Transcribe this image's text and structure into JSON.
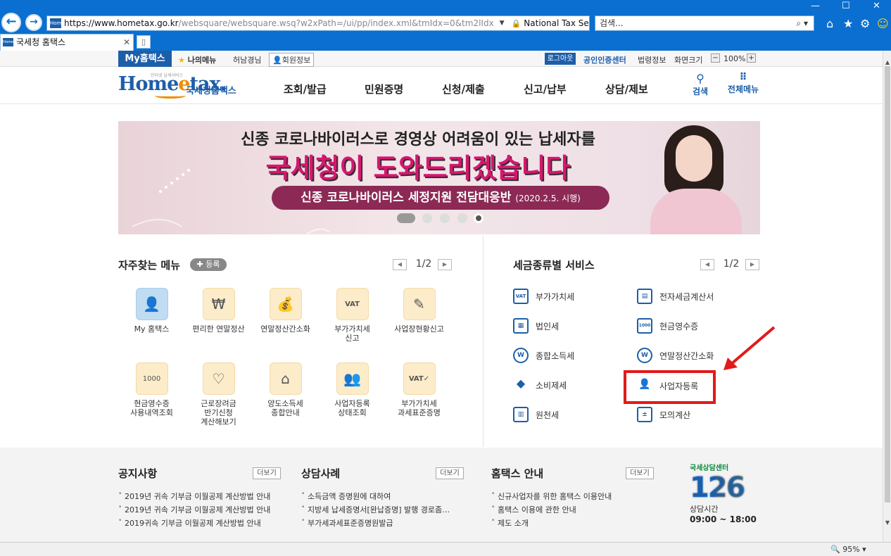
{
  "browser": {
    "url_main": "https://www.hometax.go.kr",
    "url_rest": "/websquare/websquare.wsq?w2xPath=/ui/pp/index.xml&tmIdx=0&tm2lIdx",
    "site_identity": "National Tax Service [KR]",
    "search_placeholder": "검색...",
    "tab_title": "국세청 홈택스",
    "favicon_text": "Home",
    "zoom_status": "95%"
  },
  "utility": {
    "my_hometax": "My홈택스",
    "my_menu": "나의메뉴",
    "user_name": "허남경님",
    "member_info": "회원정보",
    "logout": "로그아웃",
    "cert_center": "공인인증센터",
    "law_info": "법령정보",
    "screen_size": "화면크기",
    "zoom_value": "100%"
  },
  "header": {
    "logo_small": "인터넷 납세서비스",
    "logo_main_a": "Home",
    "logo_main_e": "e",
    "logo_main_b": "tax.",
    "logo_kr": "국세청홈택스",
    "nav": [
      "조회/발급",
      "민원증명",
      "신청/제출",
      "신고/납부",
      "상담/제보"
    ],
    "search_label": "검색",
    "all_menu_label": "전체메뉴"
  },
  "banner": {
    "line1": "신종 코로나바이러스로 경영상 어려움이 있는 납세자를",
    "line2": "국세청이 도와드리겠습니다",
    "line3": "신종 코로나바이러스 세정지원 전담대응반",
    "line3_date": "(2020.2.5. 시행)",
    "slide_count": 5,
    "active_slide": 1
  },
  "frequent_menu": {
    "title": "자주찾는 메뉴",
    "register": "등록",
    "page": "1/2",
    "items": [
      {
        "label": "My 홈택스",
        "icon": "person-icon"
      },
      {
        "label": "편리한 연말정산",
        "icon": "coins-icon"
      },
      {
        "label": "연말정산간소화",
        "icon": "money-bag-icon"
      },
      {
        "label": "부가가치세\n신고",
        "icon": "vat-icon"
      },
      {
        "label": "사업장현황신고",
        "icon": "document-edit-icon"
      },
      {
        "label": "현금영수증\n사용내역조회",
        "icon": "receipt-search-icon"
      },
      {
        "label": "근로장려금\n반기신청\n계산해보기",
        "icon": "heart-document-icon"
      },
      {
        "label": "양도소득세\n종합안내",
        "icon": "house-icon"
      },
      {
        "label": "사업자등록\n상태조회",
        "icon": "users-icon"
      },
      {
        "label": "부가가치세\n과세표준증명",
        "icon": "vat-certificate-icon"
      }
    ]
  },
  "tax_services": {
    "title": "세금종류별 서비스",
    "page": "1/2",
    "items": [
      {
        "label": "부가가치세",
        "icon": "VAT"
      },
      {
        "label": "전자세금계산서",
        "icon": "▤"
      },
      {
        "label": "법인세",
        "icon": "▦"
      },
      {
        "label": "현금영수증",
        "icon": "1000"
      },
      {
        "label": "종합소득세",
        "icon": "W"
      },
      {
        "label": "연말정산간소화",
        "icon": "W"
      },
      {
        "label": "소비제세",
        "icon": "◆"
      },
      {
        "label": "사업자등록",
        "icon": "👤"
      },
      {
        "label": "원천세",
        "icon": "▥"
      },
      {
        "label": "모의계산",
        "icon": "±"
      }
    ]
  },
  "footer": {
    "notice_title": "공지사항",
    "consult_title": "상담사례",
    "guide_title": "홈택스 안내",
    "more": "더보기",
    "notices": [
      "2019년 귀속 기부금 이월공제 계산방법 안내",
      "2019년 귀속 기부금 이월공제 계산방법 안내",
      "2019귀속 기부금 이월공제 계산방법 안내"
    ],
    "consults": [
      "소득금액 증명원에 대하여",
      "지방세 납세증명서[완납증명] 발행 경로좀…",
      "부가세과세표준증명원발급"
    ],
    "guides": [
      "신규사업자를 위한 홈택스 이용안내",
      "홈택스 이용에 관한 안내",
      "제도 소개"
    ],
    "center_caption": "국세상담센터",
    "center_number": "126",
    "hours_label": "상담시간",
    "hours": "09:00 ~ 18:00"
  },
  "colors": {
    "browser_blue": "#0a6fd0",
    "brand_blue": "#1d5ea9",
    "highlight_red": "#e21a1a",
    "banner_magenta": "#d6176f"
  }
}
